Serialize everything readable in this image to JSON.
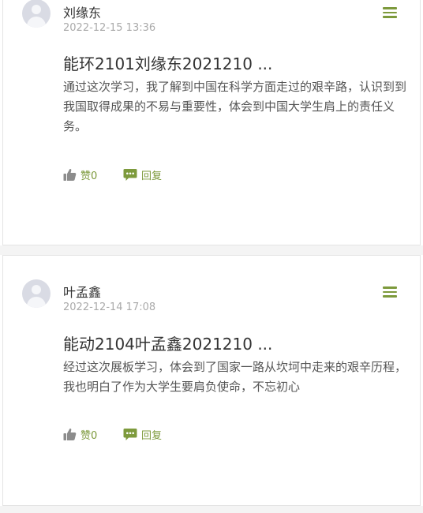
{
  "colors": {
    "accent": "#7d9a3c",
    "thumb_icon": "#8c8c8c",
    "text": "#333333",
    "muted": "#aaaaaa"
  },
  "comments": [
    {
      "author": "刘缘东",
      "time": "2022-12-15 13:36",
      "title": "能环2101刘缘东2021210 ...",
      "content": "通过这次学习，我了解到中国在科学方面走过的艰辛路，认识到到我国取得成果的不易与重要性，体会到中国大学生肩上的责任义务。",
      "like_label": "赞0",
      "reply_label": "回复",
      "avatar_icon": "default-avatar",
      "menu_icon": "hamburger-menu",
      "like_icon": "thumbs-up",
      "reply_icon": "chat-bubble"
    },
    {
      "author": "叶孟鑫",
      "time": "2022-12-14 17:08",
      "title": "能动2104叶孟鑫2021210 ...",
      "content": "经过这次展板学习，体会到了国家一路从坎坷中走来的艰辛历程，我也明白了作为大学生要肩负使命，不忘初心",
      "like_label": "赞0",
      "reply_label": "回复",
      "avatar_icon": "default-avatar",
      "menu_icon": "hamburger-menu",
      "like_icon": "thumbs-up",
      "reply_icon": "chat-bubble"
    }
  ]
}
